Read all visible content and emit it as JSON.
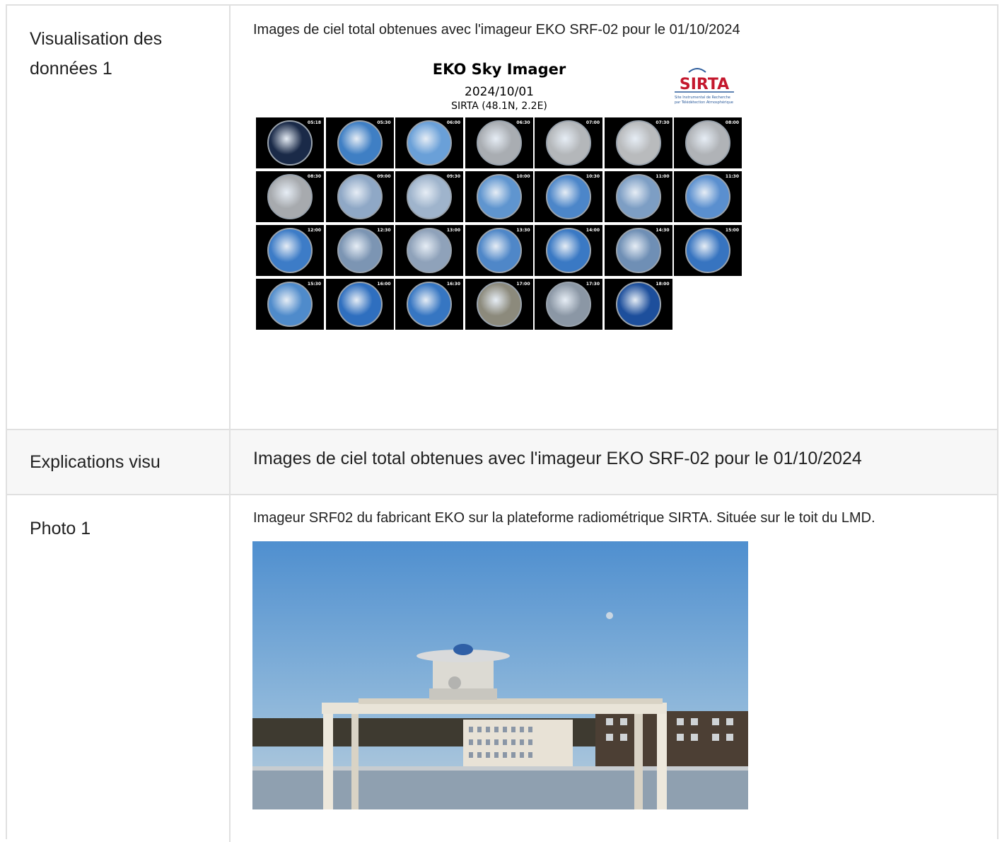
{
  "rows": [
    {
      "label": "Visualisation des données 1",
      "caption": "Images de ciel total obtenues avec l'imageur EKO SRF-02 pour le 01/10/2024",
      "figure": {
        "title": "EKO Sky Imager",
        "date": "2024/10/01",
        "site": "SIRTA (48.1N, 2.2E)",
        "logo_text": "SIRTA",
        "logo_sub1": "Site Instrumental de Recherche",
        "logo_sub2": "par Télédétection Atmosphérique",
        "times": [
          "05:18",
          "05:30",
          "06:00",
          "06:30",
          "07:00",
          "07:30",
          "08:00",
          "08:30",
          "09:00",
          "09:30",
          "10:00",
          "10:30",
          "11:00",
          "11:30",
          "12:00",
          "12:30",
          "13:00",
          "13:30",
          "14:00",
          "14:30",
          "15:00",
          "15:30",
          "16:00",
          "16:30",
          "17:00",
          "17:30",
          "18:00"
        ],
        "sky_colors": [
          "#1a2a48",
          "#3f7fc4",
          "#6aa0d8",
          "#a9adb2",
          "#b4b7ba",
          "#b9bbbd",
          "#b0b3b7",
          "#a7aaae",
          "#8fa8c6",
          "#9fb4cc",
          "#5f95cf",
          "#4c86c9",
          "#7d9ec4",
          "#5a8fcf",
          "#3d7cc7",
          "#7c95b3",
          "#8fa2ba",
          "#4f87c8",
          "#3a79c4",
          "#6f8fb5",
          "#3774c0",
          "#4f8bcb",
          "#2f6fbf",
          "#3676c2",
          "#8c8a7c",
          "#8b97a5",
          "#1d4f9c"
        ]
      }
    },
    {
      "label": "Explications visu",
      "caption": "Images de ciel total obtenues avec l'imageur EKO SRF-02 pour le 01/10/2024"
    },
    {
      "label": "Photo 1",
      "caption": "Imageur SRF02 du fabricant EKO sur la plateforme radiométrique SIRTA. Située sur le toit du LMD."
    }
  ]
}
